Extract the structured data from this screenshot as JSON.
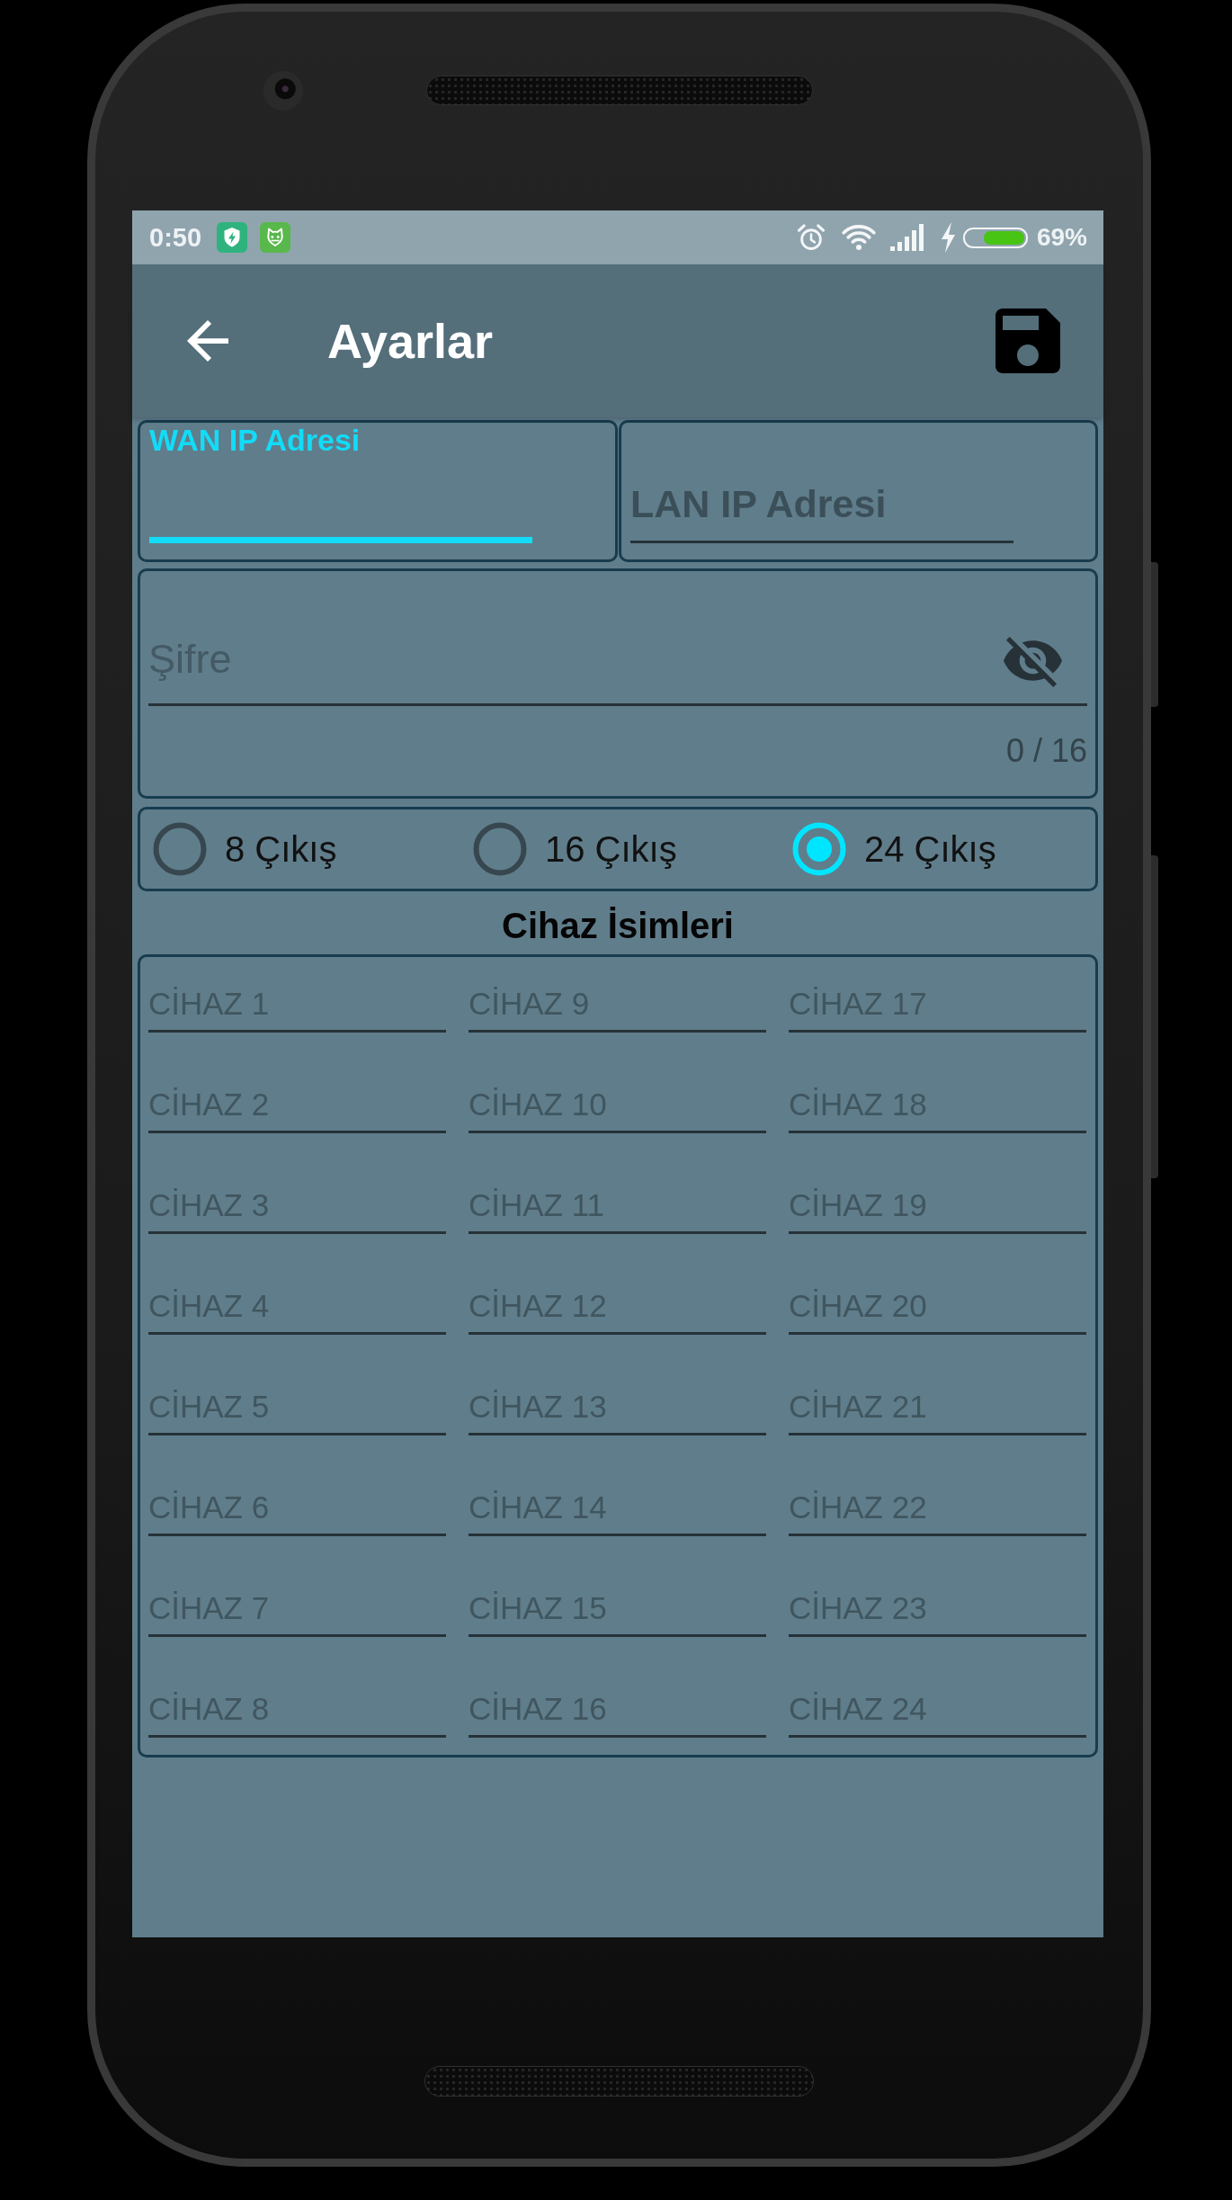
{
  "status_bar": {
    "time": "0:50",
    "battery": "69%"
  },
  "app_bar": {
    "title": "Ayarlar"
  },
  "ip_fields": [
    {
      "placeholder": "WAN IP Adresi",
      "focused": true
    },
    {
      "placeholder": "LAN IP Adresi",
      "focused": false
    }
  ],
  "password": {
    "placeholder": "Şifre",
    "counter": "0 / 16"
  },
  "outputs": [
    {
      "label": "8 Çıkış",
      "selected": false
    },
    {
      "label": "16 Çıkış",
      "selected": false
    },
    {
      "label": "24 Çıkış",
      "selected": true
    }
  ],
  "devices": {
    "title": "Cihaz İsimleri",
    "columns": [
      [
        {
          "placeholder": "CİHAZ 1"
        },
        {
          "placeholder": "CİHAZ 2"
        },
        {
          "placeholder": "CİHAZ 3"
        },
        {
          "placeholder": "CİHAZ 4"
        },
        {
          "placeholder": "CİHAZ 5"
        },
        {
          "placeholder": "CİHAZ 6"
        },
        {
          "placeholder": "CİHAZ 7"
        },
        {
          "placeholder": "CİHAZ 8"
        }
      ],
      [
        {
          "placeholder": "CİHAZ 9"
        },
        {
          "placeholder": "CİHAZ 10"
        },
        {
          "placeholder": "CİHAZ 11"
        },
        {
          "placeholder": "CİHAZ 12"
        },
        {
          "placeholder": "CİHAZ 13"
        },
        {
          "placeholder": "CİHAZ 14"
        },
        {
          "placeholder": "CİHAZ 15"
        },
        {
          "placeholder": "CİHAZ 16"
        }
      ],
      [
        {
          "placeholder": "CİHAZ 17"
        },
        {
          "placeholder": "CİHAZ 18"
        },
        {
          "placeholder": "CİHAZ 19"
        },
        {
          "placeholder": "CİHAZ 20"
        },
        {
          "placeholder": "CİHAZ 21"
        },
        {
          "placeholder": "CİHAZ 22"
        },
        {
          "placeholder": "CİHAZ 23"
        },
        {
          "placeholder": "CİHAZ 24"
        }
      ]
    ]
  }
}
